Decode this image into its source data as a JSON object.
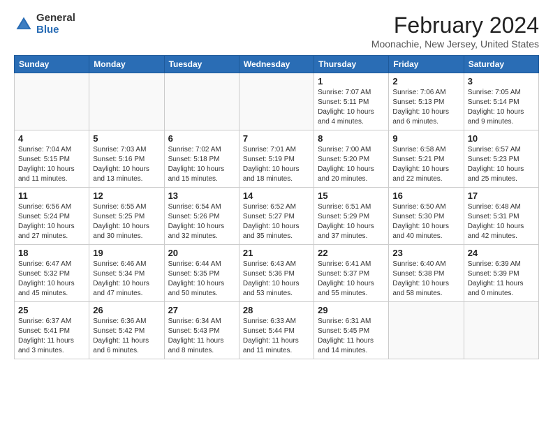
{
  "logo": {
    "general": "General",
    "blue": "Blue"
  },
  "title": "February 2024",
  "location": "Moonachie, New Jersey, United States",
  "weekdays": [
    "Sunday",
    "Monday",
    "Tuesday",
    "Wednesday",
    "Thursday",
    "Friday",
    "Saturday"
  ],
  "weeks": [
    [
      {
        "day": "",
        "info": ""
      },
      {
        "day": "",
        "info": ""
      },
      {
        "day": "",
        "info": ""
      },
      {
        "day": "",
        "info": ""
      },
      {
        "day": "1",
        "info": "Sunrise: 7:07 AM\nSunset: 5:11 PM\nDaylight: 10 hours\nand 4 minutes."
      },
      {
        "day": "2",
        "info": "Sunrise: 7:06 AM\nSunset: 5:13 PM\nDaylight: 10 hours\nand 6 minutes."
      },
      {
        "day": "3",
        "info": "Sunrise: 7:05 AM\nSunset: 5:14 PM\nDaylight: 10 hours\nand 9 minutes."
      }
    ],
    [
      {
        "day": "4",
        "info": "Sunrise: 7:04 AM\nSunset: 5:15 PM\nDaylight: 10 hours\nand 11 minutes."
      },
      {
        "day": "5",
        "info": "Sunrise: 7:03 AM\nSunset: 5:16 PM\nDaylight: 10 hours\nand 13 minutes."
      },
      {
        "day": "6",
        "info": "Sunrise: 7:02 AM\nSunset: 5:18 PM\nDaylight: 10 hours\nand 15 minutes."
      },
      {
        "day": "7",
        "info": "Sunrise: 7:01 AM\nSunset: 5:19 PM\nDaylight: 10 hours\nand 18 minutes."
      },
      {
        "day": "8",
        "info": "Sunrise: 7:00 AM\nSunset: 5:20 PM\nDaylight: 10 hours\nand 20 minutes."
      },
      {
        "day": "9",
        "info": "Sunrise: 6:58 AM\nSunset: 5:21 PM\nDaylight: 10 hours\nand 22 minutes."
      },
      {
        "day": "10",
        "info": "Sunrise: 6:57 AM\nSunset: 5:23 PM\nDaylight: 10 hours\nand 25 minutes."
      }
    ],
    [
      {
        "day": "11",
        "info": "Sunrise: 6:56 AM\nSunset: 5:24 PM\nDaylight: 10 hours\nand 27 minutes."
      },
      {
        "day": "12",
        "info": "Sunrise: 6:55 AM\nSunset: 5:25 PM\nDaylight: 10 hours\nand 30 minutes."
      },
      {
        "day": "13",
        "info": "Sunrise: 6:54 AM\nSunset: 5:26 PM\nDaylight: 10 hours\nand 32 minutes."
      },
      {
        "day": "14",
        "info": "Sunrise: 6:52 AM\nSunset: 5:27 PM\nDaylight: 10 hours\nand 35 minutes."
      },
      {
        "day": "15",
        "info": "Sunrise: 6:51 AM\nSunset: 5:29 PM\nDaylight: 10 hours\nand 37 minutes."
      },
      {
        "day": "16",
        "info": "Sunrise: 6:50 AM\nSunset: 5:30 PM\nDaylight: 10 hours\nand 40 minutes."
      },
      {
        "day": "17",
        "info": "Sunrise: 6:48 AM\nSunset: 5:31 PM\nDaylight: 10 hours\nand 42 minutes."
      }
    ],
    [
      {
        "day": "18",
        "info": "Sunrise: 6:47 AM\nSunset: 5:32 PM\nDaylight: 10 hours\nand 45 minutes."
      },
      {
        "day": "19",
        "info": "Sunrise: 6:46 AM\nSunset: 5:34 PM\nDaylight: 10 hours\nand 47 minutes."
      },
      {
        "day": "20",
        "info": "Sunrise: 6:44 AM\nSunset: 5:35 PM\nDaylight: 10 hours\nand 50 minutes."
      },
      {
        "day": "21",
        "info": "Sunrise: 6:43 AM\nSunset: 5:36 PM\nDaylight: 10 hours\nand 53 minutes."
      },
      {
        "day": "22",
        "info": "Sunrise: 6:41 AM\nSunset: 5:37 PM\nDaylight: 10 hours\nand 55 minutes."
      },
      {
        "day": "23",
        "info": "Sunrise: 6:40 AM\nSunset: 5:38 PM\nDaylight: 10 hours\nand 58 minutes."
      },
      {
        "day": "24",
        "info": "Sunrise: 6:39 AM\nSunset: 5:39 PM\nDaylight: 11 hours\nand 0 minutes."
      }
    ],
    [
      {
        "day": "25",
        "info": "Sunrise: 6:37 AM\nSunset: 5:41 PM\nDaylight: 11 hours\nand 3 minutes."
      },
      {
        "day": "26",
        "info": "Sunrise: 6:36 AM\nSunset: 5:42 PM\nDaylight: 11 hours\nand 6 minutes."
      },
      {
        "day": "27",
        "info": "Sunrise: 6:34 AM\nSunset: 5:43 PM\nDaylight: 11 hours\nand 8 minutes."
      },
      {
        "day": "28",
        "info": "Sunrise: 6:33 AM\nSunset: 5:44 PM\nDaylight: 11 hours\nand 11 minutes."
      },
      {
        "day": "29",
        "info": "Sunrise: 6:31 AM\nSunset: 5:45 PM\nDaylight: 11 hours\nand 14 minutes."
      },
      {
        "day": "",
        "info": ""
      },
      {
        "day": "",
        "info": ""
      }
    ]
  ]
}
